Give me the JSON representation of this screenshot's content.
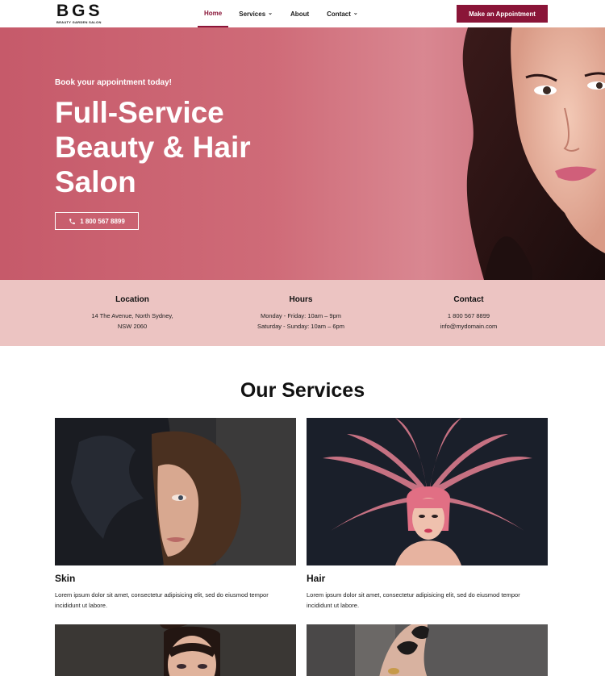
{
  "brand": {
    "mark": "BGS",
    "sub": "BEAUTY GARDEN SALON"
  },
  "nav": {
    "items": [
      {
        "label": "Home",
        "active": true
      },
      {
        "label": "Services",
        "dropdown": true
      },
      {
        "label": "About"
      },
      {
        "label": "Contact",
        "dropdown": true
      }
    ],
    "cta": "Make an Appointment"
  },
  "hero": {
    "kicker": "Book your appointment today!",
    "title": "Full-Service Beauty & Hair Salon",
    "phone": "1 800 567 8899"
  },
  "info": {
    "location": {
      "heading": "Location",
      "line1": "14 The Avenue, North Sydney,",
      "line2": "NSW 2060"
    },
    "hours": {
      "heading": "Hours",
      "line1": "Monday - Friday: 10am – 9pm",
      "line2": "Saturday - Sunday: 10am – 6pm"
    },
    "contact": {
      "heading": "Contact",
      "line1": "1 800 567 8899",
      "line2": "info@mydomain.com"
    }
  },
  "services": {
    "title": "Our Services",
    "cards": [
      {
        "title": "Skin",
        "text": "Lorem ipsum dolor sit amet, consectetur adipisicing elit, sed do eiusmod tempor incididunt ut labore."
      },
      {
        "title": "Hair",
        "text": "Lorem ipsum dolor sit amet, consectetur adipisicing elit, sed do eiusmod tempor incididunt ut labore."
      }
    ]
  },
  "colors": {
    "accent": "#8a1538",
    "hero": "#cf6b78",
    "info_band": "#ecc4c2"
  },
  "icons": {
    "phone": "phone-icon",
    "chevron": "chevron-down-icon"
  }
}
